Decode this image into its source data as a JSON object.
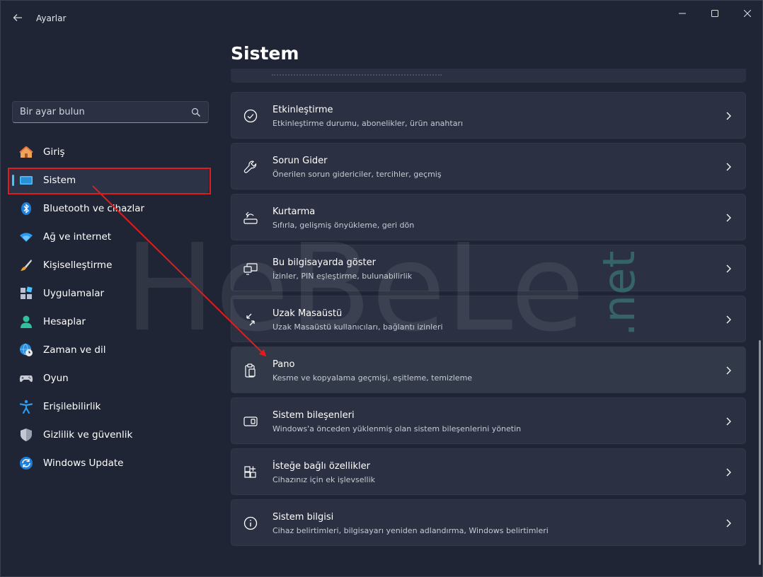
{
  "window": {
    "title": "Ayarlar"
  },
  "sidebar": {
    "search": {
      "placeholder": "Bir ayar bulun"
    },
    "items": [
      {
        "label": "Giriş",
        "icon": "home-icon"
      },
      {
        "label": "Sistem",
        "icon": "system-display-icon",
        "selected": true
      },
      {
        "label": "Bluetooth ve cihazlar",
        "icon": "bluetooth-icon"
      },
      {
        "label": "Ağ ve internet",
        "icon": "wifi-icon"
      },
      {
        "label": "Kişiselleştirme",
        "icon": "paintbrush-icon"
      },
      {
        "label": "Uygulamalar",
        "icon": "apps-icon"
      },
      {
        "label": "Hesaplar",
        "icon": "person-icon"
      },
      {
        "label": "Zaman ve dil",
        "icon": "globe-clock-icon"
      },
      {
        "label": "Oyun",
        "icon": "gamepad-icon"
      },
      {
        "label": "Erişilebilirlik",
        "icon": "accessibility-icon"
      },
      {
        "label": "Gizlilik ve güvenlik",
        "icon": "shield-icon"
      },
      {
        "label": "Windows Update",
        "icon": "update-icon"
      }
    ]
  },
  "main": {
    "title": "Sistem",
    "cards": [
      {
        "title": "Etkinleştirme",
        "desc": "Etkinleştirme durumu, abonelikler, ürün anahtarı",
        "icon": "checkmark-circle-icon"
      },
      {
        "title": "Sorun Gider",
        "desc": "Önerilen sorun gidericiler, tercihler, geçmiş",
        "icon": "wrench-icon"
      },
      {
        "title": "Kurtarma",
        "desc": "Sıfırla, gelişmiş önyükleme, geri dön",
        "icon": "recovery-icon"
      },
      {
        "title": "Bu bilgisayarda göster",
        "desc": "İzinler, PIN eşleştirme, bulunabilirlik",
        "icon": "project-screen-icon"
      },
      {
        "title": "Uzak Masaüstü",
        "desc": "Uzak Masaüstü kullanıcıları, bağlantı izinleri",
        "icon": "remote-desktop-icon"
      },
      {
        "title": "Pano",
        "desc": "Kesme ve kopyalama geçmişi, eşitleme, temizleme",
        "icon": "clipboard-icon",
        "hover": true
      },
      {
        "title": "Sistem bileşenleri",
        "desc": "Windows'a önceden yüklenmiş olan sistem bileşenlerini yönetin",
        "icon": "components-icon"
      },
      {
        "title": "İsteğe bağlı özellikler",
        "desc": "Cihazınız için ek işlevsellik",
        "icon": "optional-features-icon"
      },
      {
        "title": "Sistem bilgisi",
        "desc": "Cihaz belirtimleri, bilgisayarı yeniden adlandırma, Windows belirtimleri",
        "icon": "info-icon"
      }
    ]
  },
  "watermark": {
    "text": "HeBeLe",
    "suffix": ".net"
  },
  "colors": {
    "accent": "#4cc2ff",
    "annotation": "#e01d1d",
    "background": "#1f2535",
    "card": "#2b3142"
  }
}
